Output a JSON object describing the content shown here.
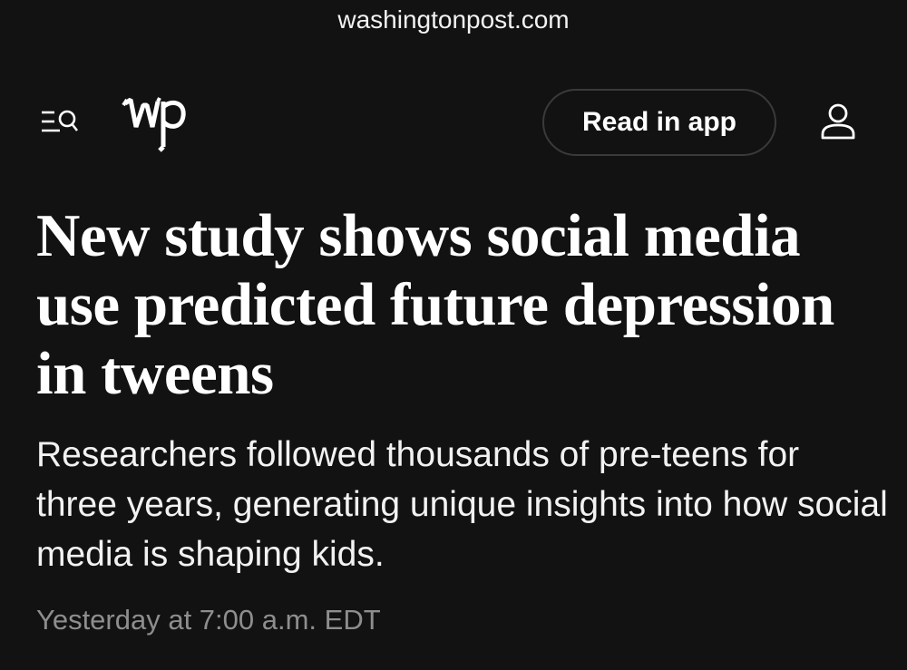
{
  "browser": {
    "url": "washingtonpost.com"
  },
  "nav": {
    "menu_icon": "menu-search-icon",
    "logo_text": "wp",
    "read_in_app_label": "Read in app",
    "account_icon": "account-icon"
  },
  "article": {
    "headline": "New study shows social media use predicted future depression in tweens",
    "dek": "Researchers followed thousands of pre-teens for three years, generating unique insights into how social media is shaping kids.",
    "timestamp": "Yesterday at 7:00 a.m. EDT"
  },
  "colors": {
    "background": "#121212",
    "text": "#ffffff",
    "timestamp": "#8e8e8e",
    "button_border": "#3a3a3a"
  }
}
